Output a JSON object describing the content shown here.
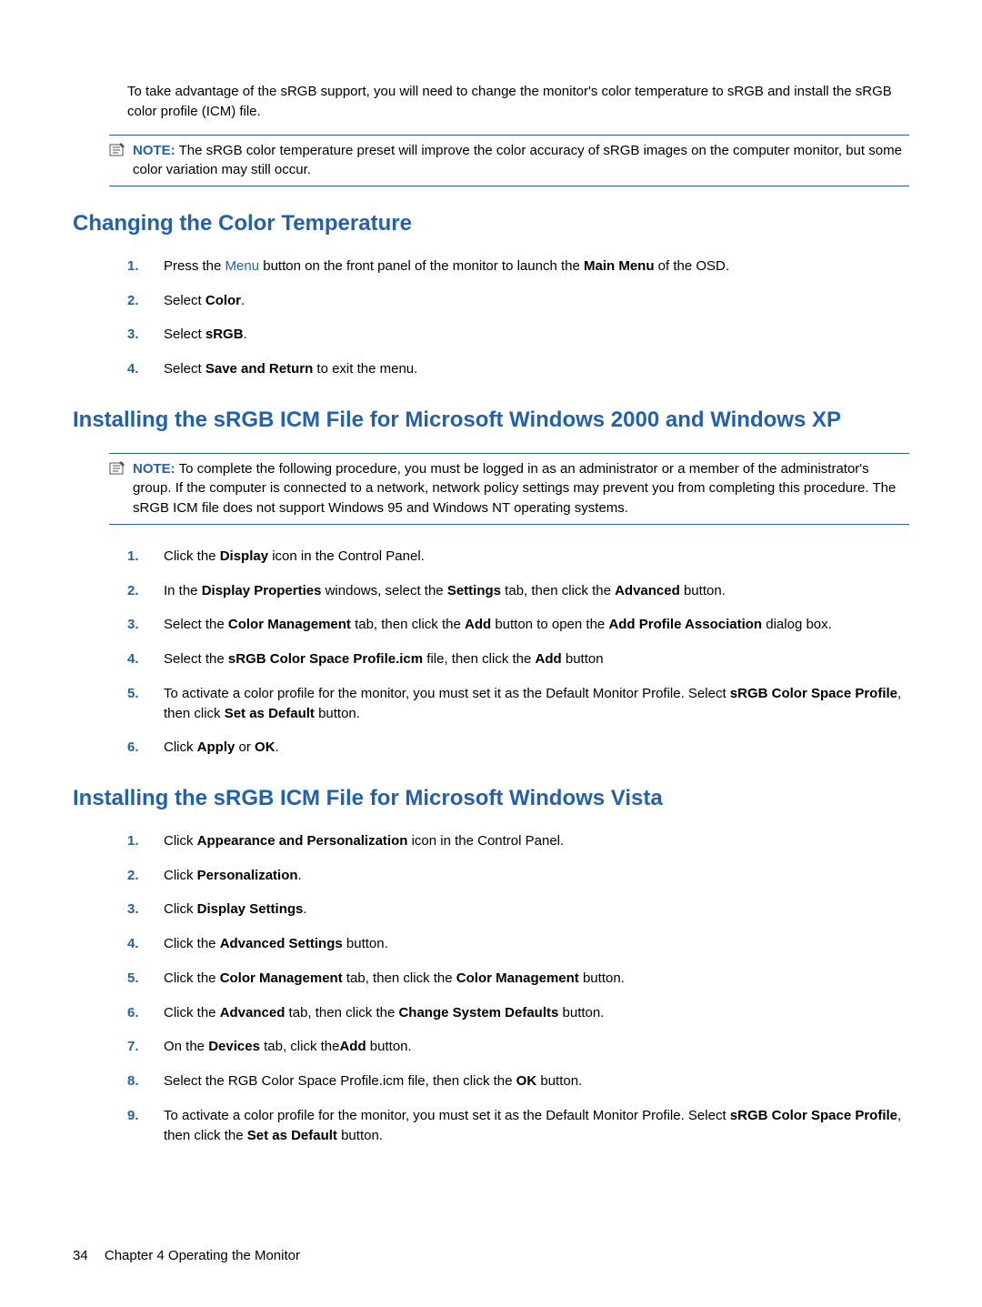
{
  "intro": "To take advantage of the sRGB support, you will need to change the monitor's color temperature to sRGB and install the sRGB color profile (ICM) file.",
  "note1": {
    "label": "NOTE:",
    "text": "The sRGB color temperature preset will improve the color accuracy of sRGB images on the computer monitor, but some color variation may still occur."
  },
  "sec1": {
    "title": "Changing the Color Temperature",
    "steps": [
      {
        "num": "1.",
        "pre": "Press the ",
        "link": "Menu",
        "mid": " button on the front panel of the monitor to launch the ",
        "bold1": "Main Menu",
        "post": " of the OSD."
      },
      {
        "num": "2.",
        "pre": "Select ",
        "bold1": "Color",
        "post": "."
      },
      {
        "num": "3.",
        "pre": "Select ",
        "bold1": "sRGB",
        "post": "."
      },
      {
        "num": "4.",
        "pre": "Select ",
        "bold1": "Save and Return",
        "post": " to exit the menu."
      }
    ]
  },
  "sec2": {
    "title": "Installing the sRGB ICM File for Microsoft Windows 2000 and Windows XP",
    "note": {
      "label": "NOTE:",
      "text": "To complete the following procedure, you must be logged in as an administrator or a member of the administrator's group. If the computer is connected to a network, network policy settings may prevent you from completing this procedure. The sRGB ICM file does not support Windows 95 and Windows NT operating systems."
    },
    "steps": [
      {
        "num": "1.",
        "parts": [
          {
            "t": "Click the "
          },
          {
            "b": "Display"
          },
          {
            "t": " icon in the Control Panel."
          }
        ]
      },
      {
        "num": "2.",
        "parts": [
          {
            "t": "In the "
          },
          {
            "b": "Display Properties"
          },
          {
            "t": " windows, select the "
          },
          {
            "b": "Settings"
          },
          {
            "t": " tab, then click the "
          },
          {
            "b": "Advanced"
          },
          {
            "t": " button."
          }
        ]
      },
      {
        "num": "3.",
        "parts": [
          {
            "t": "Select the "
          },
          {
            "b": "Color Management"
          },
          {
            "t": " tab, then click the "
          },
          {
            "b": "Add"
          },
          {
            "t": " button to open the "
          },
          {
            "b": "Add Profile Association"
          },
          {
            "t": " dialog box."
          }
        ]
      },
      {
        "num": "4.",
        "parts": [
          {
            "t": "Select the "
          },
          {
            "b": "sRGB Color Space Profile.icm"
          },
          {
            "t": " file, then click the "
          },
          {
            "b": "Add"
          },
          {
            "t": " button"
          }
        ]
      },
      {
        "num": "5.",
        "parts": [
          {
            "t": "To activate a color profile for the monitor, you must set it as the Default Monitor Profile. Select "
          },
          {
            "b": "sRGB Color Space Profile"
          },
          {
            "t": ", then click "
          },
          {
            "b": "Set as Default"
          },
          {
            "t": " button."
          }
        ]
      },
      {
        "num": "6.",
        "parts": [
          {
            "t": "Click "
          },
          {
            "b": "Apply"
          },
          {
            "t": " or "
          },
          {
            "b": "OK"
          },
          {
            "t": "."
          }
        ]
      }
    ]
  },
  "sec3": {
    "title": "Installing the sRGB ICM File for Microsoft Windows Vista",
    "steps": [
      {
        "num": "1.",
        "parts": [
          {
            "t": "Click "
          },
          {
            "b": "Appearance and Personalization"
          },
          {
            "t": " icon in the Control Panel."
          }
        ]
      },
      {
        "num": "2.",
        "parts": [
          {
            "t": "Click "
          },
          {
            "b": "Personalization"
          },
          {
            "t": "."
          }
        ]
      },
      {
        "num": "3.",
        "parts": [
          {
            "t": "Click "
          },
          {
            "b": "Display Settings"
          },
          {
            "t": "."
          }
        ]
      },
      {
        "num": "4.",
        "parts": [
          {
            "t": "Click the "
          },
          {
            "b": "Advanced Settings"
          },
          {
            "t": " button."
          }
        ]
      },
      {
        "num": "5.",
        "parts": [
          {
            "t": "Click the "
          },
          {
            "b": "Color Management"
          },
          {
            "t": " tab, then click the "
          },
          {
            "b": "Color Management"
          },
          {
            "t": " button."
          }
        ]
      },
      {
        "num": "6.",
        "parts": [
          {
            "t": "Click the "
          },
          {
            "b": "Advanced"
          },
          {
            "t": " tab, then click the "
          },
          {
            "b": "Change System Defaults"
          },
          {
            "t": " button."
          }
        ]
      },
      {
        "num": "7.",
        "parts": [
          {
            "t": "On the "
          },
          {
            "b": "Devices"
          },
          {
            "t": " tab, click the"
          },
          {
            "b": "Add"
          },
          {
            "t": " button."
          }
        ]
      },
      {
        "num": "8.",
        "parts": [
          {
            "t": "Select the RGB Color Space Profile.icm file, then click the "
          },
          {
            "b": "OK"
          },
          {
            "t": " button."
          }
        ]
      },
      {
        "num": "9.",
        "parts": [
          {
            "t": "To activate a color profile for the monitor, you must set it as the Default Monitor Profile. Select "
          },
          {
            "b": "sRGB Color Space Profile"
          },
          {
            "t": ", then click the "
          },
          {
            "b": "Set as Default"
          },
          {
            "t": " button."
          }
        ]
      }
    ]
  },
  "footer": {
    "page": "34",
    "chapter": "Chapter 4   Operating the Monitor"
  }
}
